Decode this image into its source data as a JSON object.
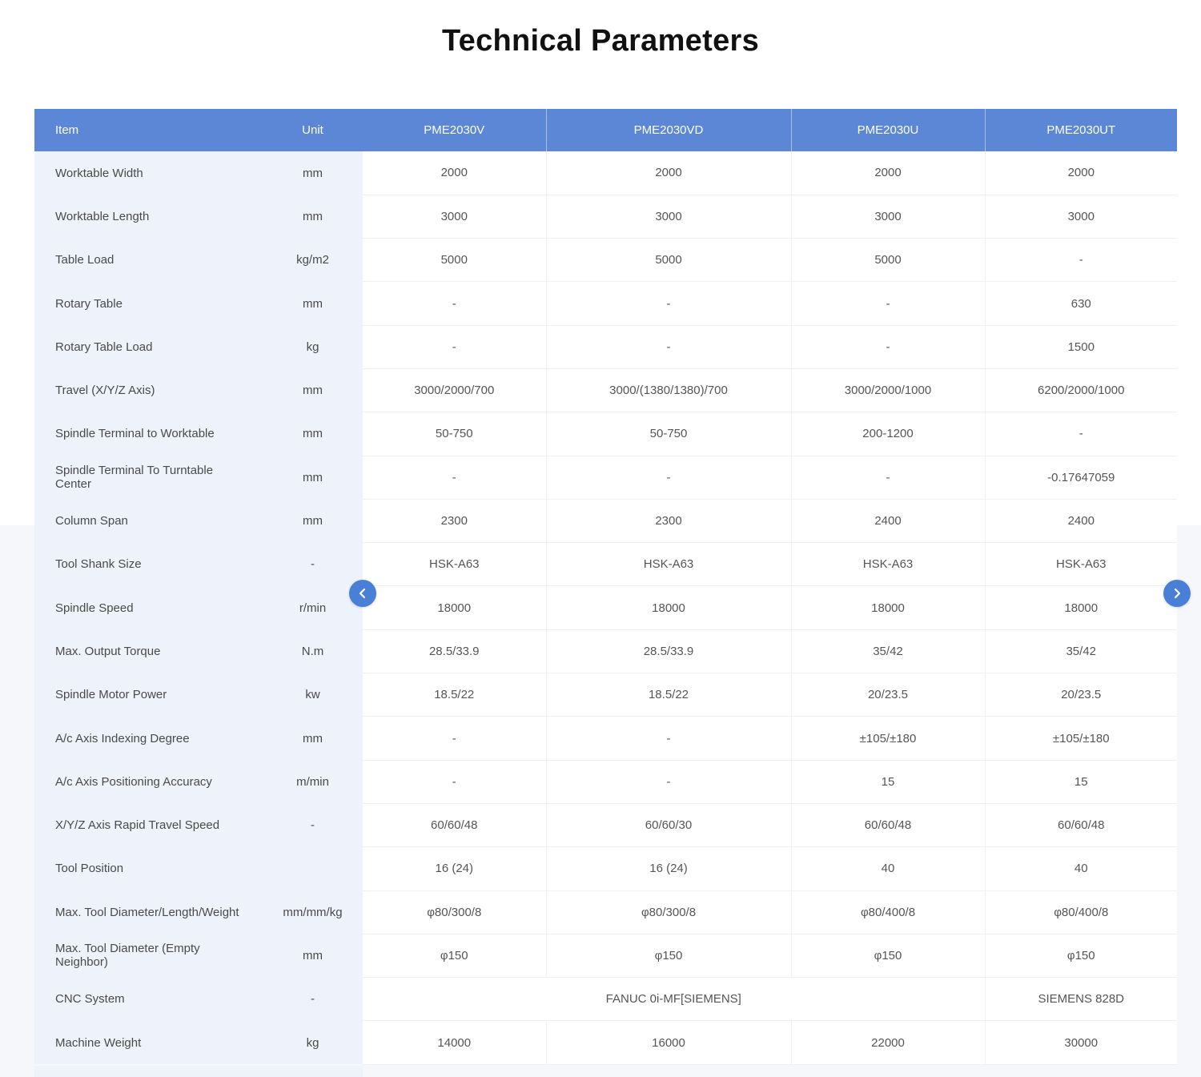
{
  "title": "Technical Parameters",
  "table": {
    "headers": {
      "item": "Item",
      "unit": "Unit",
      "models": [
        "PME2030V",
        "PME2030VD",
        "PME2030U",
        "PME2030UT"
      ]
    },
    "rows": [
      {
        "item": "Worktable  Width",
        "unit": "mm",
        "values": [
          "2000",
          "2000",
          "2000",
          "2000"
        ]
      },
      {
        "item": "Worktable Length",
        "unit": "mm",
        "values": [
          "3000",
          "3000",
          "3000",
          "3000"
        ]
      },
      {
        "item": "Table Load",
        "unit": "kg/m2",
        "values": [
          "5000",
          "5000",
          "5000",
          "-"
        ]
      },
      {
        "item": "Rotary Table",
        "unit": "mm",
        "values": [
          "-",
          "-",
          "-",
          "630"
        ]
      },
      {
        "item": "Rotary Table Load",
        "unit": "kg",
        "values": [
          "-",
          "-",
          "-",
          "1500"
        ]
      },
      {
        "item": "Travel (X/Y/Z Axis)",
        "unit": "mm",
        "values": [
          "3000/2000/700",
          "3000/(1380/1380)/700",
          "3000/2000/1000",
          "6200/2000/1000"
        ]
      },
      {
        "item": "Spindle Terminal to Worktable",
        "unit": "mm",
        "values": [
          "50-750",
          "50-750",
          "200-1200",
          "-"
        ]
      },
      {
        "item": "Spindle Terminal To Turntable Center",
        "unit": "mm",
        "values": [
          "-",
          "-",
          "-",
          "-0.17647059"
        ]
      },
      {
        "item": "Column Span",
        "unit": "mm",
        "values": [
          "2300",
          "2300",
          "2400",
          "2400"
        ]
      },
      {
        "item": "Tool Shank Size",
        "unit": "-",
        "values": [
          "HSK-A63",
          "HSK-A63",
          "HSK-A63",
          "HSK-A63"
        ]
      },
      {
        "item": "Spindle Speed",
        "unit": "r/min",
        "values": [
          "18000",
          "18000",
          "18000",
          "18000"
        ]
      },
      {
        "item": "Max. Output Torque",
        "unit": "N.m",
        "values": [
          "28.5/33.9",
          "28.5/33.9",
          "35/42",
          "35/42"
        ]
      },
      {
        "item": "Spindle Motor Power",
        "unit": "kw",
        "values": [
          "18.5/22",
          "18.5/22",
          "20/23.5",
          "20/23.5"
        ]
      },
      {
        "item": "A/c Axis Indexing Degree",
        "unit": "mm",
        "values": [
          "-",
          "-",
          "±105/±180",
          "±105/±180"
        ]
      },
      {
        "item": "A/c Axis Positioning Accuracy",
        "unit": "m/min",
        "values": [
          "-",
          "-",
          "15",
          "15"
        ]
      },
      {
        "item": "X/Y/Z Axis Rapid Travel Speed",
        "unit": "-",
        "values": [
          "60/60/48",
          "60/60/30",
          "60/60/48",
          "60/60/48"
        ]
      },
      {
        "item": "Tool Position",
        "unit": "",
        "values": [
          "16  (24)",
          "16  (24)",
          "40",
          "40"
        ]
      },
      {
        "item": "Max. Tool   Diameter/Length/Weight",
        "unit": "mm/mm/kg",
        "values": [
          "φ80/300/8",
          "φ80/300/8",
          "φ80/400/8",
          "φ80/400/8"
        ]
      },
      {
        "item": "Max. Tool Diameter (Empty Neighbor)",
        "unit": "mm",
        "values": [
          "φ150",
          "φ150",
          "φ150",
          "φ150"
        ]
      },
      {
        "item": "CNC System",
        "unit": "-",
        "merged_value": "FANUC 0i-MF[SIEMENS]",
        "last_value": "SIEMENS  828D"
      },
      {
        "item": "Machine Weight",
        "unit": "kg",
        "values": [
          "14000",
          "16000",
          "22000",
          "30000"
        ]
      }
    ]
  },
  "nav": {
    "prev_icon": "chevron-left-icon",
    "next_icon": "chevron-right-icon"
  },
  "colors": {
    "header_bg": "#5b87d6",
    "label_col_bg": "#eef2fa",
    "nav_button": "#4a7fd8"
  }
}
